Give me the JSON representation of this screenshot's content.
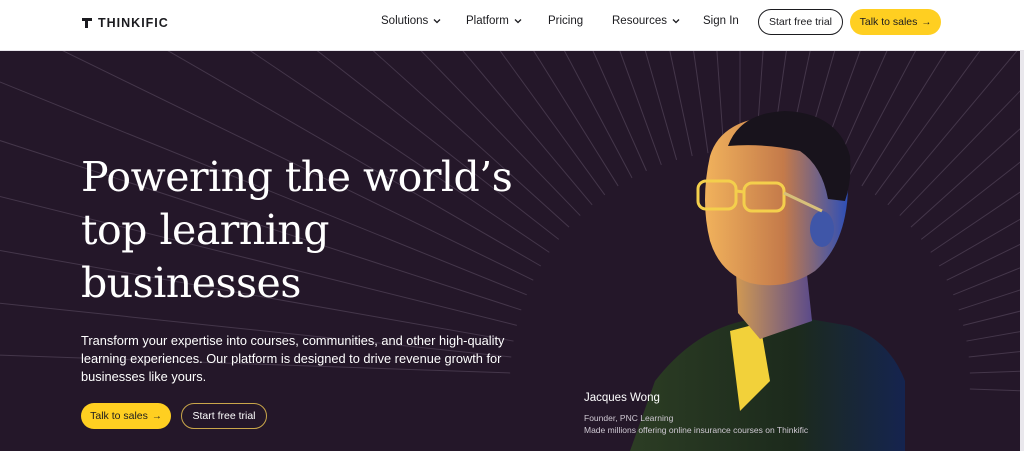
{
  "brand": {
    "name": "THINKIFIC"
  },
  "nav": {
    "items": [
      {
        "label": "Solutions",
        "has_dropdown": true
      },
      {
        "label": "Platform",
        "has_dropdown": true
      },
      {
        "label": "Pricing",
        "has_dropdown": false
      },
      {
        "label": "Resources",
        "has_dropdown": true
      },
      {
        "label": "Sign In",
        "has_dropdown": false
      }
    ],
    "start_trial_label": "Start free trial",
    "talk_sales_label": "Talk to sales",
    "arrow_icon": "arrow-right-icon"
  },
  "hero": {
    "headline_lines": [
      "Powering the world’s",
      "top learning",
      "businesses"
    ],
    "subtext": "Transform your expertise into courses, communities, and other high-quality learning experiences. Our platform is designed to drive revenue growth for businesses like yours.",
    "talk_sales_label": "Talk to sales",
    "start_trial_label": "Start free trial",
    "testimonial": {
      "name": "Jacques Wong",
      "title": "Founder, PNC Learning",
      "quote": "Made millions offering online insurance courses on Thinkific"
    }
  },
  "colors": {
    "hero_bg": "#241729",
    "accent_yellow": "#ffcf21",
    "text_dark": "#1b1b1f",
    "text_light": "#ffffff"
  }
}
